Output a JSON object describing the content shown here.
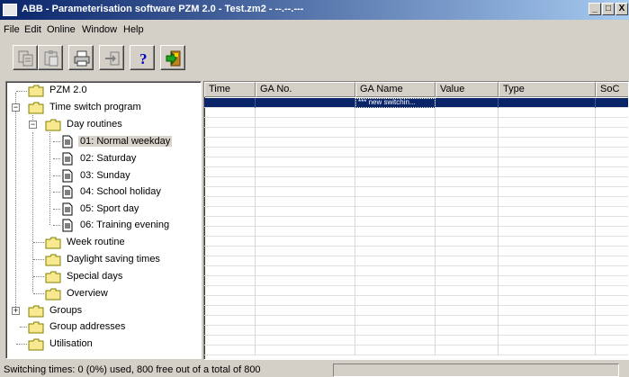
{
  "window": {
    "title": "ABB - Parameterisation software PZM 2.0 - Test.zm2 - --.--.---",
    "minimize": "_",
    "maximize": "□",
    "close": "X"
  },
  "menu": [
    "File",
    "Edit",
    "Online",
    "Window",
    "Help"
  ],
  "toolbar": {
    "buttons": [
      {
        "name": "copy-icon"
      },
      {
        "name": "paste-icon"
      },
      {
        "name": "print-icon"
      },
      {
        "name": "import-icon"
      },
      {
        "name": "help-icon",
        "label": "?"
      },
      {
        "name": "exit-icon"
      }
    ]
  },
  "tree": {
    "root": "PZM 2.0",
    "time_switch": "Time switch program",
    "day_routines": "Day routines",
    "routines": [
      "01: Normal weekday",
      "02: Saturday",
      "03: Sunday",
      "04: School holiday",
      "05: Sport day",
      "06: Training evening"
    ],
    "week_routine": "Week routine",
    "daylight": "Daylight saving times",
    "special_days": "Special days",
    "overview": "Overview",
    "groups": "Groups",
    "group_addresses": "Group addresses",
    "utilisation": "Utilisation"
  },
  "grid": {
    "columns": [
      "Time",
      "GA No.",
      "GA Name",
      "Value",
      "Type",
      "SoC"
    ],
    "new_row_text": "*** new switchin..."
  },
  "status": {
    "text": "Switching times: 0 (0%) used, 800 free out of a total of 800"
  }
}
